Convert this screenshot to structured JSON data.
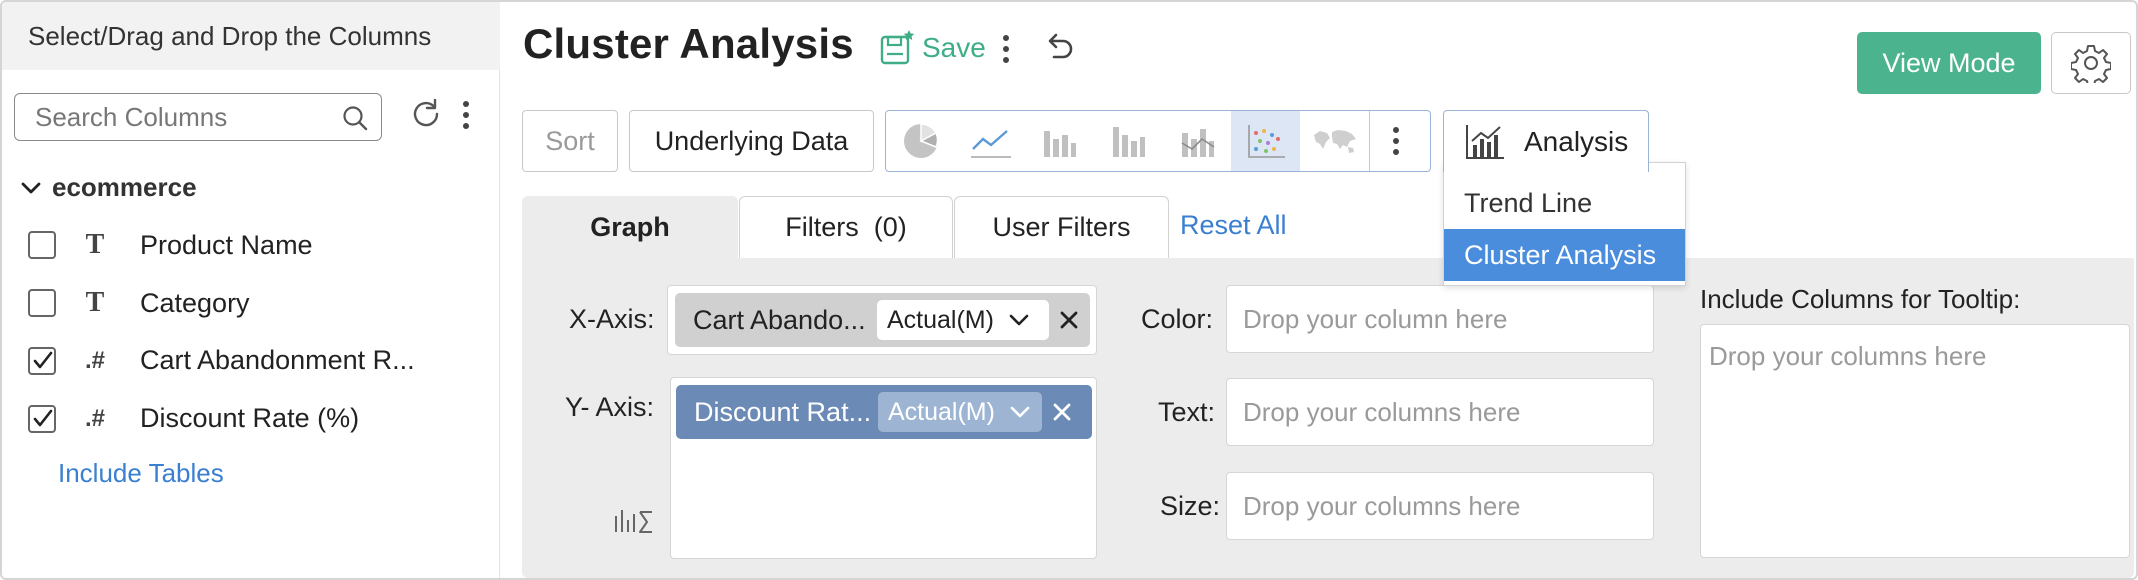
{
  "left_panel": {
    "header": "Select/Drag and Drop the Columns",
    "search_placeholder": "Search Columns",
    "table_name": "ecommerce",
    "columns": [
      {
        "name": "Product Name",
        "type_glyph": "T",
        "checked": false
      },
      {
        "name": "Category",
        "type_glyph": "T",
        "checked": false
      },
      {
        "name": "Cart Abandonment R...",
        "type_glyph": ".#",
        "checked": true
      },
      {
        "name": "Discount Rate (%)",
        "type_glyph": ".#",
        "checked": true
      }
    ],
    "include_tables": "Include Tables"
  },
  "header": {
    "title": "Cluster Analysis",
    "save_label": "Save",
    "view_mode_label": "View Mode"
  },
  "toolbar": {
    "sort_label": "Sort",
    "underlying_data_label": "Underlying Data",
    "chart_types": [
      "pie-chart-icon",
      "line-chart-icon",
      "bar-chart-icon",
      "stacked-bar-chart-icon",
      "combo-chart-icon",
      "scatter-chart-icon",
      "world-map-icon"
    ],
    "active_chart_type": "scatter-chart-icon",
    "analysis_label": "Analysis",
    "analysis_menu": [
      "Trend Line",
      "Cluster Analysis"
    ],
    "analysis_selected": "Cluster Analysis"
  },
  "tabs": {
    "graph": "Graph",
    "filters": "Filters",
    "filters_count": "(0)",
    "user_filters": "User Filters",
    "reset_all": "Reset All"
  },
  "shelves": {
    "x_axis_label": "X-Axis:",
    "x_axis_column": "Cart Abando...",
    "x_axis_agg": "Actual(M)",
    "y_axis_label": "Y- Axis:",
    "y_axis_column": "Discount Rat...",
    "y_axis_agg": "Actual(M)",
    "color_label": "Color:",
    "color_placeholder": "Drop your column here",
    "text_label": "Text:",
    "text_placeholder": "Drop your columns here",
    "size_label": "Size:",
    "size_placeholder": "Drop your columns here",
    "tooltip_label": "Include Columns for Tooltip:",
    "tooltip_placeholder": "Drop your columns here"
  },
  "colors": {
    "accent_green": "#4cb38f",
    "link_blue": "#3a7fd0",
    "selection_blue": "#4a8ddc",
    "y_pill": "#6b8ab5"
  }
}
